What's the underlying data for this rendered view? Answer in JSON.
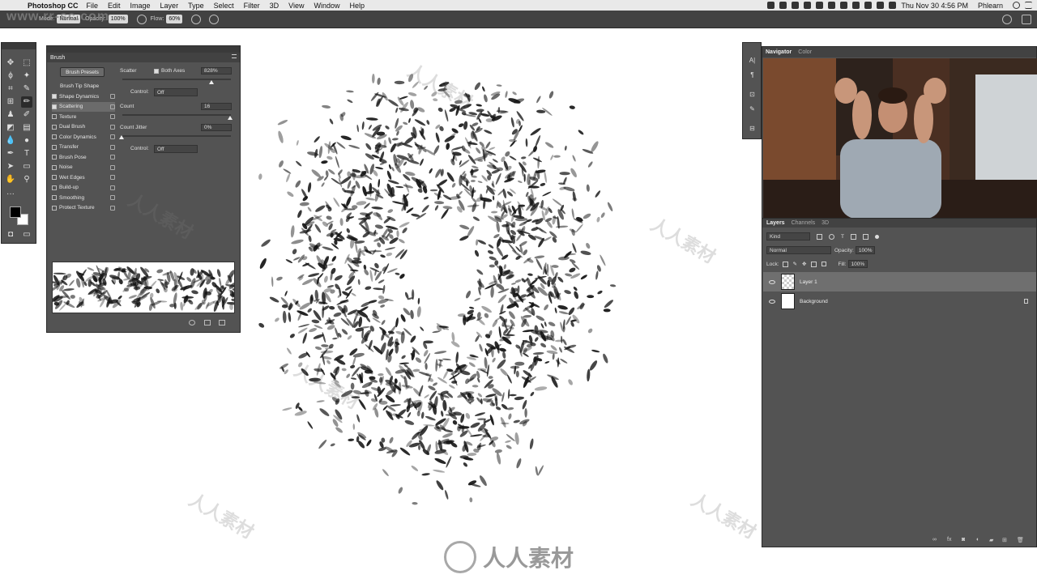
{
  "menubar": {
    "app_name": "Photoshop CC",
    "items": [
      "File",
      "Edit",
      "Image",
      "Layer",
      "Type",
      "Select",
      "Filter",
      "3D",
      "View",
      "Window",
      "Help"
    ],
    "clock": "Thu Nov 30  4:56 PM",
    "user": "Phlearn"
  },
  "options": {
    "mode_label": "Mode:",
    "mode_value": "Normal",
    "opacity_label": "Opacity:",
    "opacity_value": "100%",
    "flow_label": "Flow:",
    "flow_value": "60%"
  },
  "brush_panel": {
    "title": "Brush",
    "presets_button": "Brush Presets",
    "tip_shape": "Brush Tip Shape",
    "options": [
      {
        "label": "Shape Dynamics",
        "checked": true
      },
      {
        "label": "Scattering",
        "checked": true
      },
      {
        "label": "Texture",
        "checked": false
      },
      {
        "label": "Dual Brush",
        "checked": false
      },
      {
        "label": "Color Dynamics",
        "checked": false
      },
      {
        "label": "Transfer",
        "checked": false
      },
      {
        "label": "Brush Pose",
        "checked": false
      },
      {
        "label": "Noise",
        "checked": false
      },
      {
        "label": "Wet Edges",
        "checked": false
      },
      {
        "label": "Build-up",
        "checked": false
      },
      {
        "label": "Smoothing",
        "checked": false
      },
      {
        "label": "Protect Texture",
        "checked": false
      }
    ],
    "scatter_label": "Scatter",
    "both_axes_label": "Both Axes",
    "scatter_value": "828%",
    "control_label": "Control:",
    "control_value": "Off",
    "count_label": "Count",
    "count_value": "16",
    "count_jitter_label": "Count Jitter",
    "count_jitter_value": "0%",
    "control2_label": "Control:",
    "control2_value": "Off"
  },
  "navigator": {
    "tabs": [
      "Navigator",
      "Color"
    ]
  },
  "layers": {
    "tabs": [
      "Layers",
      "Channels",
      "3D"
    ],
    "kind_label": "Kind",
    "blend_mode": "Normal",
    "opacity_label": "Opacity:",
    "opacity_value": "100%",
    "lock_label": "Lock:",
    "fill_label": "Fill:",
    "fill_value": "100%",
    "items": [
      {
        "name": "Layer 1",
        "selected": true
      },
      {
        "name": "Background",
        "selected": false
      }
    ]
  },
  "watermark": {
    "site": "www.rr-sc.com",
    "brand": "人人素材"
  },
  "colors": {
    "panel_bg": "#535353",
    "panel_dark": "#424242",
    "menubar_bg": "#e9e9e9"
  }
}
